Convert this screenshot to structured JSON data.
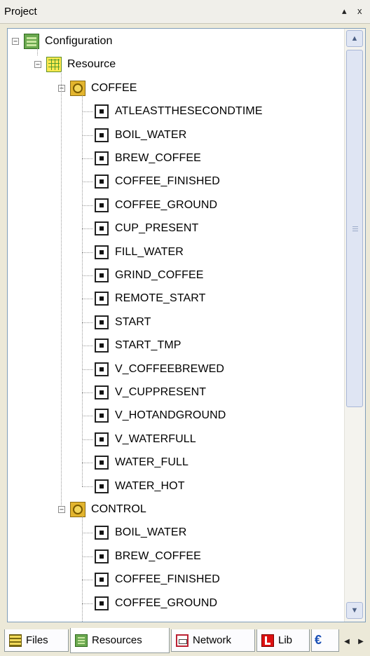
{
  "titlebar": {
    "title": "Project",
    "pin_glyph": "▴",
    "close_glyph": "x"
  },
  "tree": {
    "root": {
      "label": "Configuration",
      "icon": "configuration-icon",
      "expander": "−"
    },
    "resource": {
      "label": "Resource",
      "icon": "resource-icon",
      "expander": "−"
    },
    "tasks": [
      {
        "label": "COFFEE",
        "icon": "task-icon",
        "expander": "−",
        "variables": [
          "ATLEASTTHESECONDTIME",
          "BOIL_WATER",
          "BREW_COFFEE",
          "COFFEE_FINISHED",
          "COFFEE_GROUND",
          "CUP_PRESENT",
          "FILL_WATER",
          "GRIND_COFFEE",
          "REMOTE_START",
          "START",
          "START_TMP",
          "V_COFFEEBREWED",
          "V_CUPPRESENT",
          "V_HOTANDGROUND",
          "V_WATERFULL",
          "WATER_FULL",
          "WATER_HOT"
        ]
      },
      {
        "label": "CONTROL",
        "icon": "task-icon",
        "expander": "−",
        "variables": [
          "BOIL_WATER",
          "BREW_COFFEE",
          "COFFEE_FINISHED",
          "COFFEE_GROUND"
        ]
      }
    ]
  },
  "scrollbar": {
    "up_glyph": "▲",
    "down_glyph": "▼"
  },
  "tabs": [
    {
      "label": "Files",
      "icon": "files-icon",
      "active": false
    },
    {
      "label": "Resources",
      "icon": "resources-icon",
      "active": true
    },
    {
      "label": "Network",
      "icon": "network-icon",
      "active": false
    },
    {
      "label": "Lib",
      "icon": "library-icon",
      "active": false
    }
  ],
  "tab_nav": {
    "partial_glyph": "€",
    "prev_glyph": "◀",
    "next_glyph": "▶"
  }
}
